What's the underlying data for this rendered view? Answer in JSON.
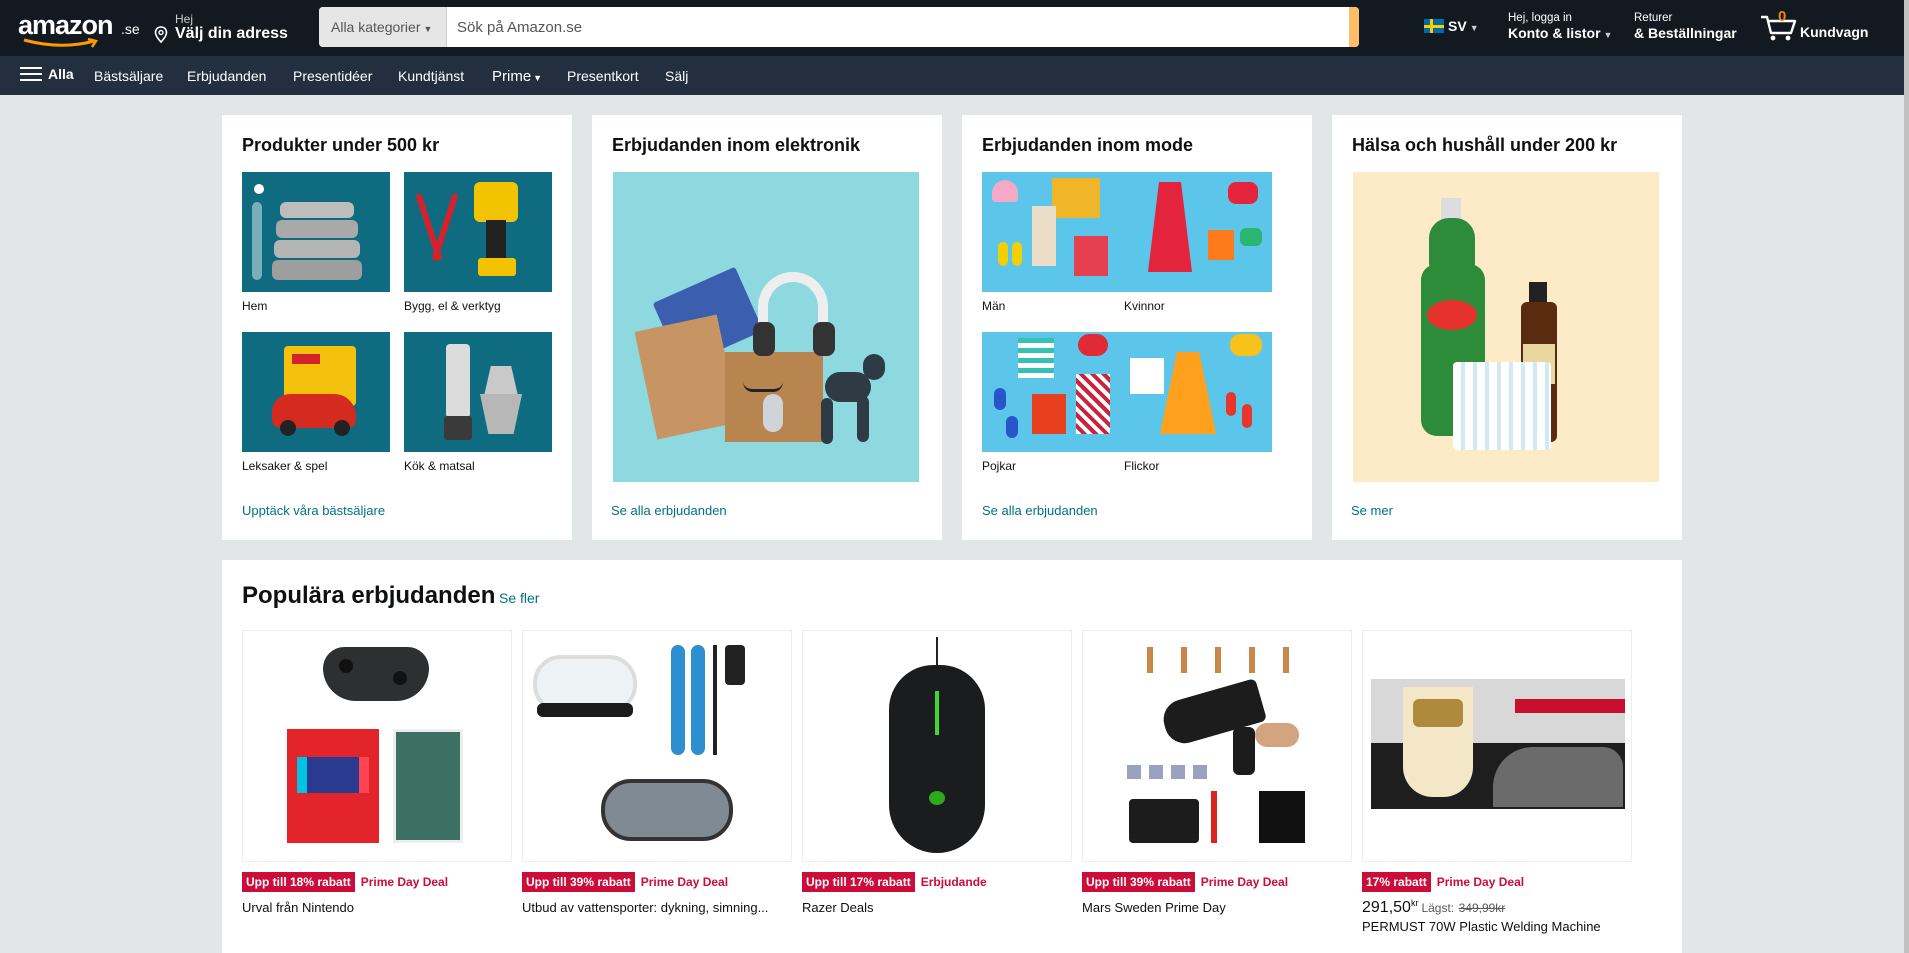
{
  "header": {
    "logo_text": "amazon",
    "logo_tld": ".se",
    "address_greeting": "Hej",
    "address_label": "Välj din adress",
    "search_category": "Alla kategorier",
    "search_placeholder": "Sök på Amazon.se",
    "language": "SV",
    "account_greeting": "Hej, logga in",
    "account_label": "Konto & listor",
    "orders_top": "Returer",
    "orders_label": "& Beställningar",
    "cart_count": "0",
    "cart_label": "Kundvagn"
  },
  "subnav": {
    "all": "Alla",
    "items": [
      "Bästsäljare",
      "Erbjudanden",
      "Presentidéer",
      "Kundtjänst",
      "Prime",
      "Presentkort",
      "Sälj"
    ]
  },
  "cards": [
    {
      "title": "Produkter under 500 kr",
      "items": [
        "Hem",
        "Bygg, el & verktyg",
        "Leksaker & spel",
        "Kök & matsal"
      ],
      "link": "Upptäck våra bästsäljare"
    },
    {
      "title": "Erbjudanden inom elektronik",
      "link": "Se alla erbjudanden"
    },
    {
      "title": "Erbjudanden inom mode",
      "items": [
        "Män",
        "Kvinnor",
        "Pojkar",
        "Flickor"
      ],
      "link": "Se alla erbjudanden"
    },
    {
      "title": "Hälsa och hushåll under 200 kr",
      "link": "Se mer"
    }
  ],
  "popular": {
    "title": "Populära erbjudanden",
    "see_more": "Se fler",
    "deals": [
      {
        "badge": "Upp till 18% rabatt",
        "type": "Prime Day Deal",
        "title": "Urval från Nintendo"
      },
      {
        "badge": "Upp till 39% rabatt",
        "type": "Prime Day Deal",
        "title": "Utbud av vattensporter: dykning, simning..."
      },
      {
        "badge": "Upp till 17% rabatt",
        "type": "Erbjudande",
        "title": "Razer Deals"
      },
      {
        "badge": "Upp till 39% rabatt",
        "type": "Prime Day Deal",
        "title": "Mars Sweden Prime Day"
      },
      {
        "badge": "17% rabatt",
        "type": "Prime Day Deal",
        "price": "291,50",
        "currency": "kr",
        "lowest_label": "Lägst:",
        "lowest_price": "349,99kr",
        "title": "PERMUST 70W Plastic Welding Machine"
      }
    ]
  },
  "colors": {
    "nav_bg": "#131921",
    "subnav_bg": "#232f3e",
    "search_button": "#febd69",
    "deal_red": "#cc0c39",
    "link": "#007185"
  }
}
